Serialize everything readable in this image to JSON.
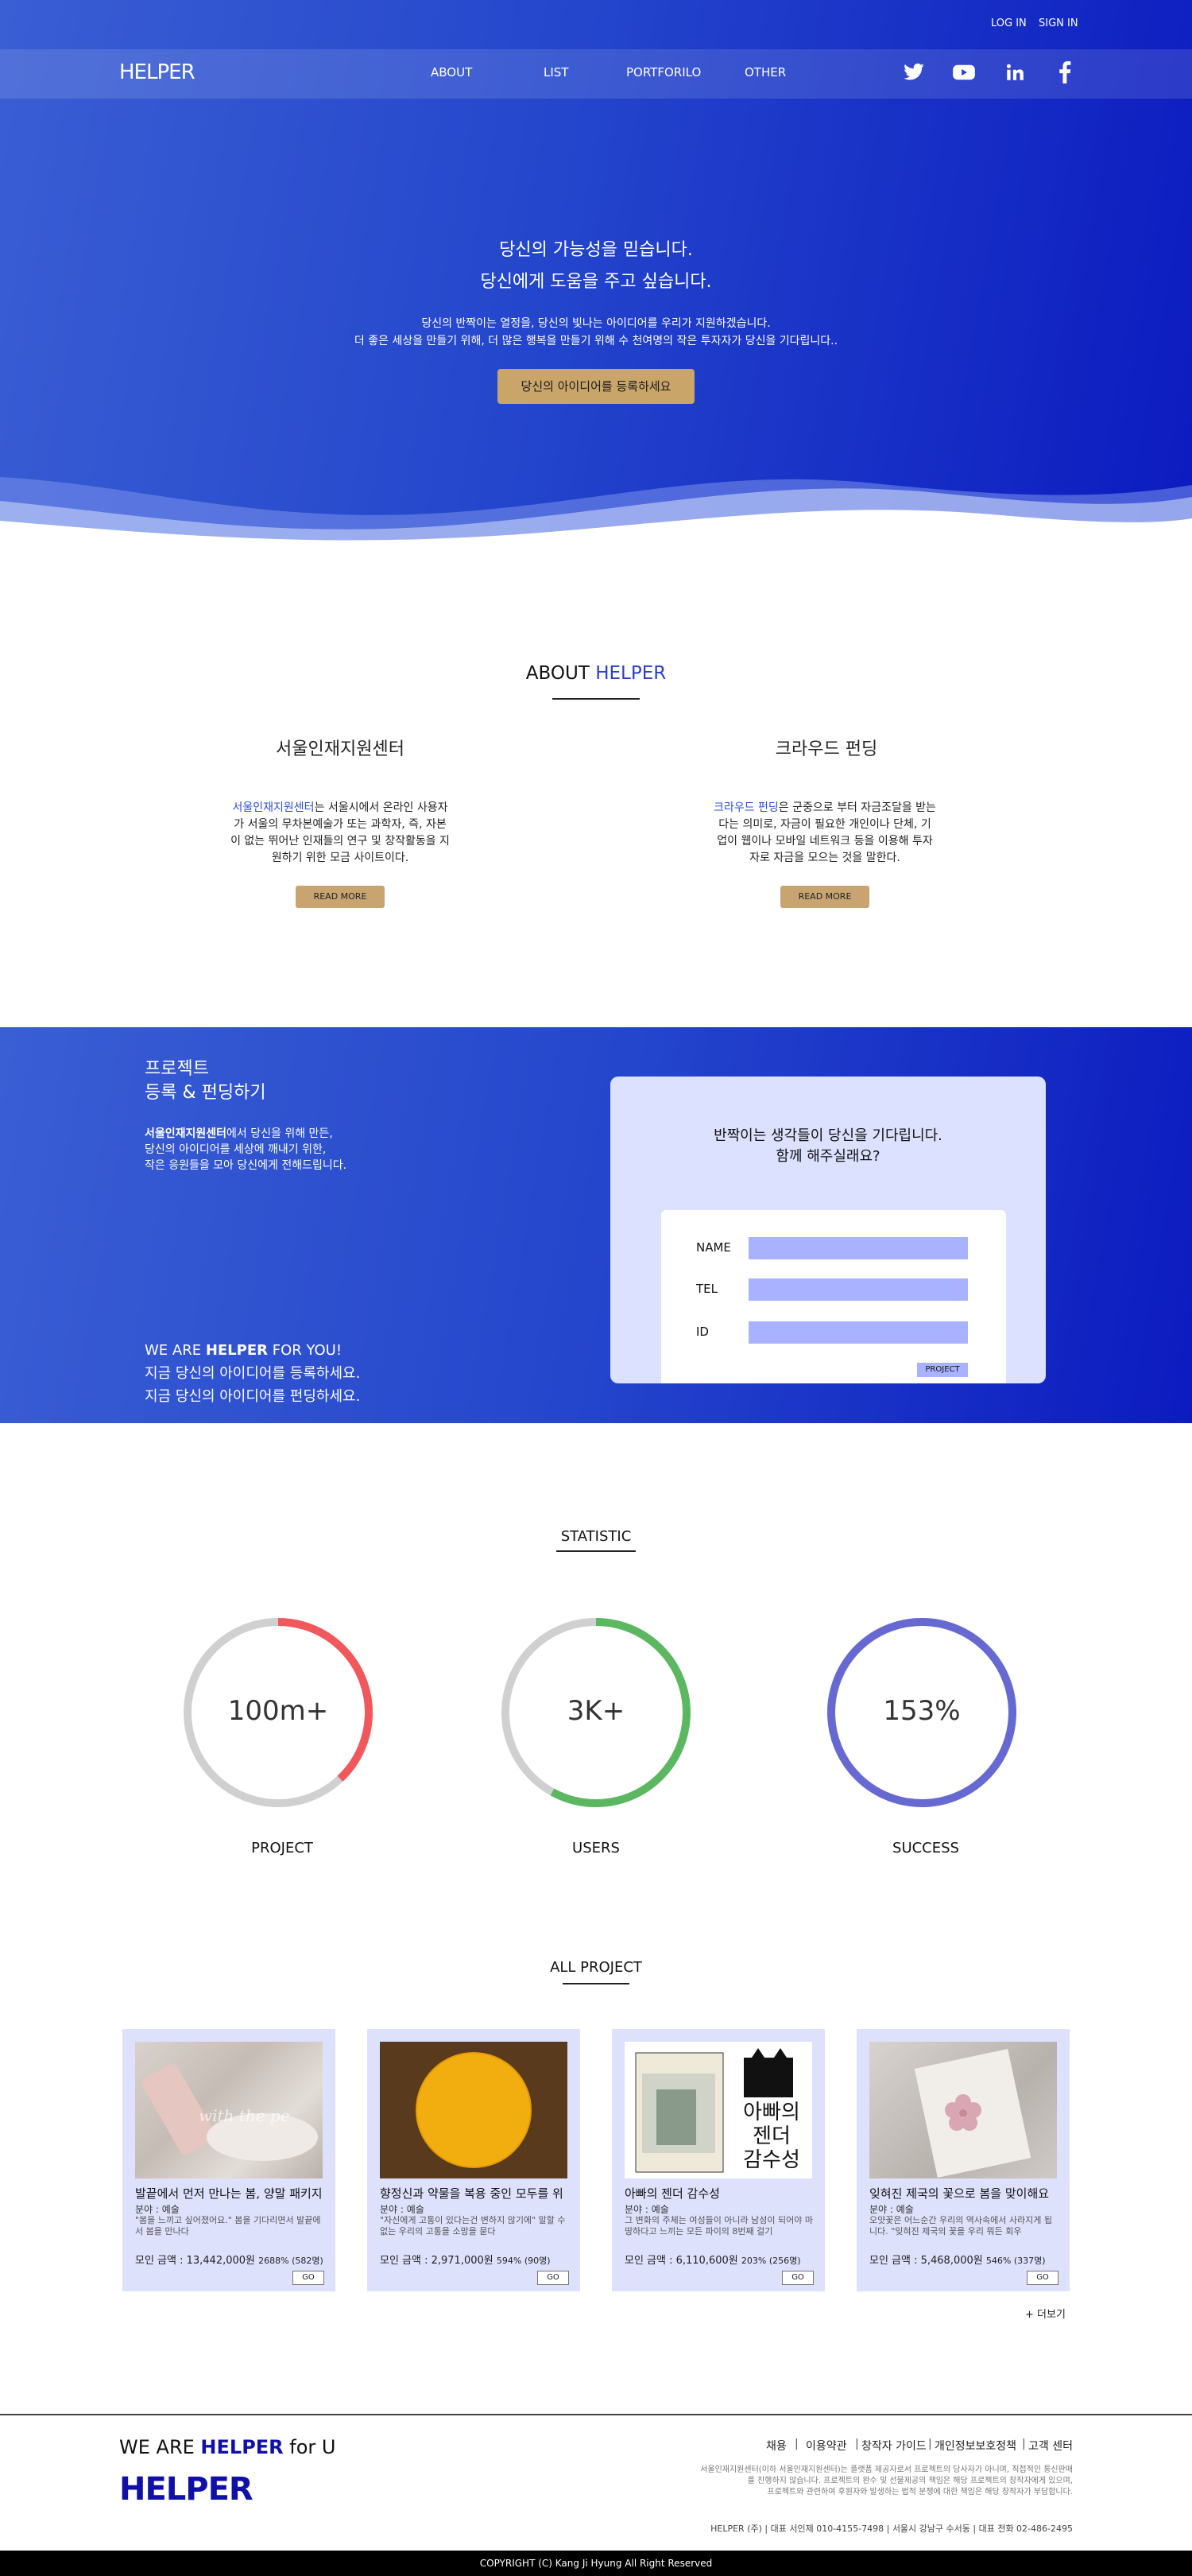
{
  "topbar": {
    "login": "LOG IN",
    "signin": "SIGN IN"
  },
  "nav": {
    "logo": "HELPER",
    "items": [
      "ABOUT",
      "LIST",
      "PORTFORILO",
      "OTHER"
    ],
    "social": [
      "twitter-icon",
      "youtube-icon",
      "linkedin-icon",
      "facebook-icon"
    ]
  },
  "hero": {
    "line1": "당신의 가능성을 믿습니다.",
    "line2": "당신에게 도움을 주고 싶습니다.",
    "desc1": "당신의 반짝이는 열정을, 당신의 빛나는 아이디어를 우리가 지원하겠습니다.",
    "desc2": "더 좋은 세상을 만들기 위해, 더 많은 행복을 만들기 위해 수 천여명의 작은 투자자가 당신을 기다립니다..",
    "button": "당신의 아이디어를 등록하세요"
  },
  "about": {
    "title_pre": "ABOUT ",
    "title_hl": "HELPER",
    "cols": [
      {
        "heading": "서울인재지원센터",
        "hl": "서울인재지원센터",
        "text_rest": "는 서울시에서 온라인 사용자가 서울의 무차본예술가 또는 과학자, 즉, 자본이 없는 뛰어난 인재들의 연구 및 창작활동을 지원하기 위한 모금 사이트이다.",
        "button": "READ MORE"
      },
      {
        "heading": "크라우드 펀딩",
        "hl": "크라우드 펀딩",
        "text_rest": "은 군중으로 부터 자금조달을 받는다는 의미로, 자금이 필요한 개인이나 단체, 기업이 웹이나 모바일 네트워크 등을 이용해 투자자로 자금을 모으는 것을 말한다.",
        "button": "READ MORE"
      }
    ]
  },
  "project": {
    "title1": "프로젝트",
    "title2": "등록  & 펀딩하기",
    "desc_bold": "서울인재지원센터",
    "desc1_rest": "에서 당신을 위해 만든,",
    "desc2": "당신의 아이디어를 세상에 깨내기 위한,",
    "desc3": "작은 응원들을 모아 당신에게 전해드립니다.",
    "slogan_pre": "WE ARE ",
    "slogan_bold": "HELPER",
    "slogan_post": " FOR YOU!",
    "cta1": "지금 당신의 아이디어를 등록하세요.",
    "cta2": "지금 당신의 아이디어를 펀딩하세요.",
    "card_title1": "반짝이는 생각들이 당신을 기다립니다.",
    "card_title2": "함께 해주실래요?",
    "fields": [
      {
        "label": "NAME",
        "value": ""
      },
      {
        "label": "TEL",
        "value": ""
      },
      {
        "label": "ID",
        "value": ""
      }
    ],
    "button": "PROJECT"
  },
  "statistic": {
    "title": "STATISTIC",
    "items": [
      {
        "value": "100m+",
        "label": "PROJECT",
        "fraction": 0.38,
        "color": "#f0585b"
      },
      {
        "value": "3K+",
        "label": "USERS",
        "fraction": 0.58,
        "color": "#5cb860"
      },
      {
        "value": "153%",
        "label": "SUCCESS",
        "fraction": 1.0,
        "color": "#6769d2"
      }
    ]
  },
  "all_project": {
    "title": "ALL PROJECT",
    "more": "+ 더보기",
    "go": "GO",
    "items": [
      {
        "title": "발끝에서 먼저 만나는 봄, 양말 패키지",
        "category": "분야 : 예술",
        "desc": "\"봄을 느끼고 싶어졌어요.\" 봄을 기다리면서 발끝에서 봄을 만나다",
        "amount": "모인 금액 : 13,442,000원",
        "stats": "2688% (582명)"
      },
      {
        "title": "향정신과 약물을 복용 중인 모두를 위",
        "category": "분야 : 예술",
        "desc": "\"자신에게 고통이 있다는건 변하지 않기에\" 말할 수 없는 우리의 고통을 소망을 묻다",
        "amount": "모인 금액 : 2,971,000원",
        "stats": "594% (90명)"
      },
      {
        "title": "아빠의 젠더 감수성",
        "category": "분야 : 예술",
        "desc": "그 변화의 주체는 여성들이 아니라 남성이 되어야 마땅하다고 느끼는 모든 파이의 8번째 걸기",
        "amount": "모인 금액 : 6,110,600원",
        "stats": "203% (256명)"
      },
      {
        "title": "잊혀진 제국의 꽃으로 봄을 맞이해요",
        "category": "분야 : 예술",
        "desc": "오얏꽃은 어느순간 우리의 역사속에서 사라지게 됩니다. \"잊혀진 제국의 꽃을 우리 뭐든 회우",
        "amount": "모인 금액 : 5,468,000원",
        "stats": "546% (337명)"
      }
    ],
    "book_cover_text": [
      "아빠의",
      "젠더",
      "감수성"
    ]
  },
  "footer": {
    "slogan_pre": "WE ARE ",
    "slogan_bold": "HELPER",
    "slogan_post": " for U",
    "logo": "HELPER",
    "menu": [
      "채용",
      "이용약관",
      "창작자 가이드",
      "개인정보보호정책",
      "고객 센터"
    ],
    "desc1": "서울인재지원센터(이하 서울인재지원센터)는 플랫폼 제공자로서 프로젝트의 당사자가 아니며, 직접적인 통신판매",
    "desc2": "를 진행하지 않습니다. 프로젝트의 완수 및 선물제공의 책임은 해당 프로젝트의 창작자에게 있으며,",
    "desc3": "프로젝트와 관련하여 후원자와 발생하는 법적 분쟁에 대한 책임은 해당 창작자가 부담합니다.",
    "info": "HELPER (주)  |  대표 서인제 010-4155-7498  |  서울시 강남구 수서동  |  대표 전화 02-486-2495",
    "copyright": "COPYRIGHT (C) Kang Ji Hyung All Right Reserved"
  }
}
